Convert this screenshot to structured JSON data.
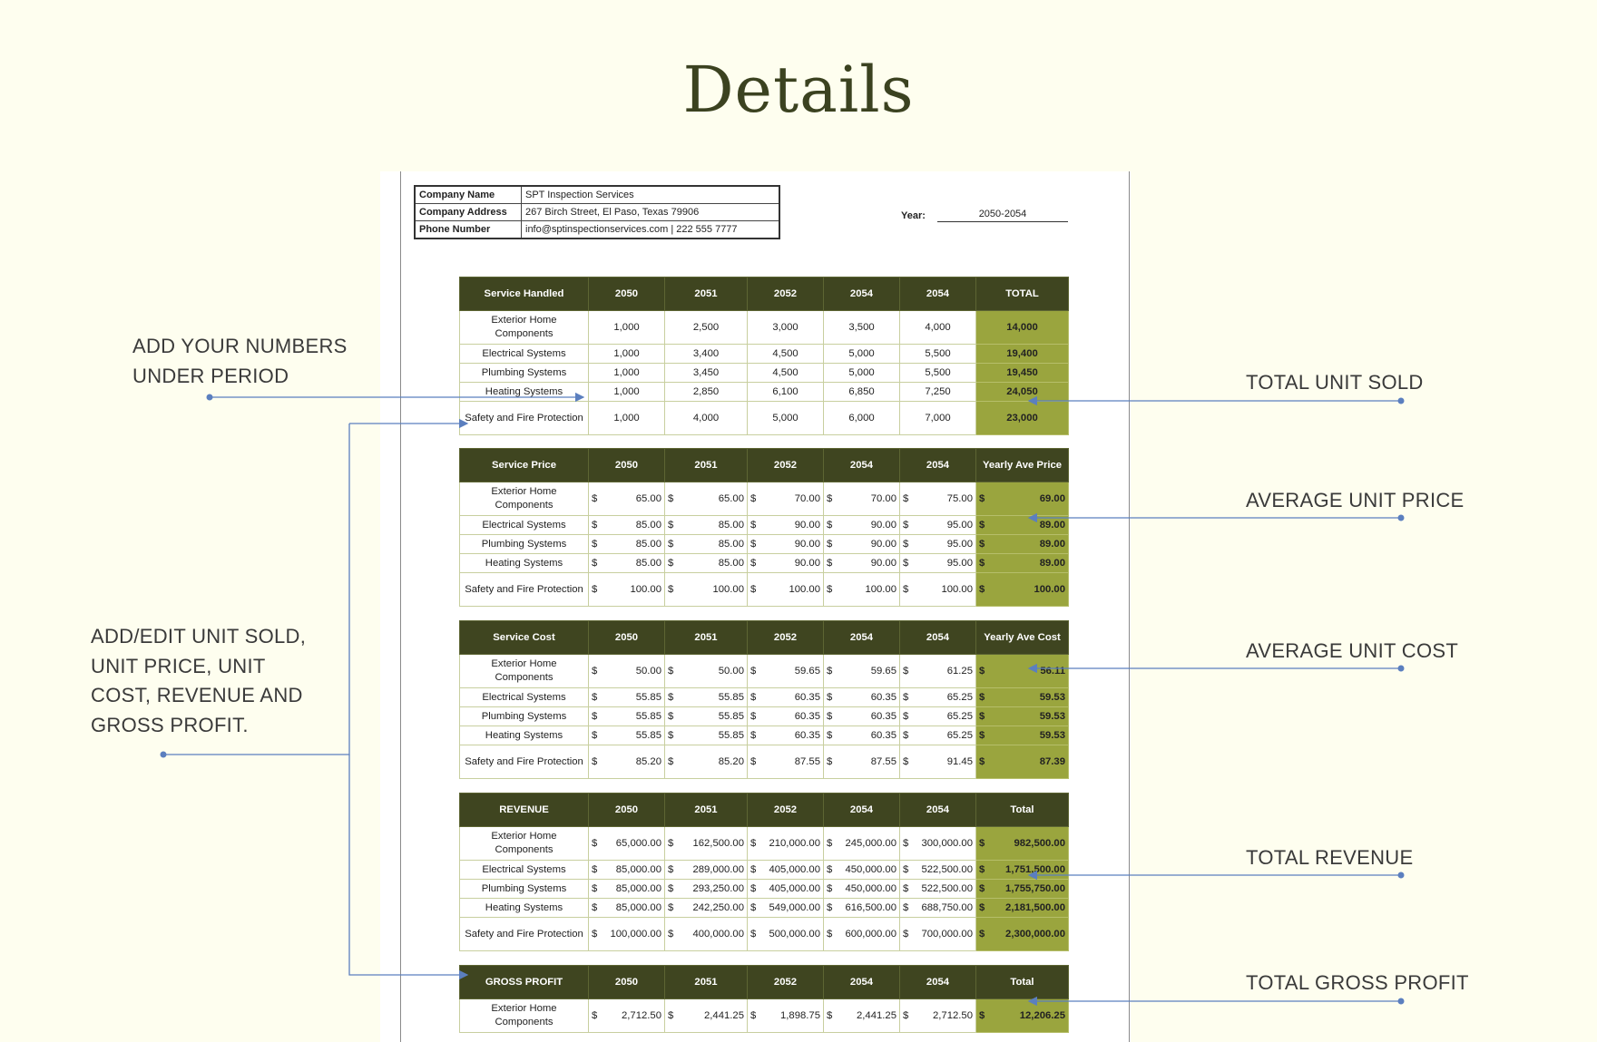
{
  "title": "Details",
  "company": {
    "rows": [
      {
        "label": "Company Name",
        "value": "SPT Inspection Services"
      },
      {
        "label": "Company Address",
        "value": "267 Birch Street, El Paso, Texas 79906"
      },
      {
        "label": "Phone Number",
        "value": "info@sptinspectionservices.com  |  222 555 7777"
      }
    ],
    "year_label": "Year:",
    "year_value": "2050-2054"
  },
  "services": [
    "Exterior Home Components",
    "Electrical Systems",
    "Plumbing Systems",
    "Heating Systems",
    "Safety and Fire Protection"
  ],
  "years": [
    "2050",
    "2051",
    "2052",
    "2054",
    "2054"
  ],
  "tables": [
    {
      "header": "Service Handled",
      "total_header": "TOTAL",
      "currency": false,
      "rows": [
        [
          "1,000",
          "2,500",
          "3,000",
          "3,500",
          "4,000",
          "14,000"
        ],
        [
          "1,000",
          "3,400",
          "4,500",
          "5,000",
          "5,500",
          "19,400"
        ],
        [
          "1,000",
          "3,450",
          "4,500",
          "5,000",
          "5,500",
          "19,450"
        ],
        [
          "1,000",
          "2,850",
          "6,100",
          "6,850",
          "7,250",
          "24,050"
        ],
        [
          "1,000",
          "4,000",
          "5,000",
          "6,000",
          "7,000",
          "23,000"
        ]
      ]
    },
    {
      "header": "Service Price",
      "total_header": "Yearly Ave Price",
      "currency": true,
      "rows": [
        [
          "65.00",
          "65.00",
          "70.00",
          "70.00",
          "75.00",
          "69.00"
        ],
        [
          "85.00",
          "85.00",
          "90.00",
          "90.00",
          "95.00",
          "89.00"
        ],
        [
          "85.00",
          "85.00",
          "90.00",
          "90.00",
          "95.00",
          "89.00"
        ],
        [
          "85.00",
          "85.00",
          "90.00",
          "90.00",
          "95.00",
          "89.00"
        ],
        [
          "100.00",
          "100.00",
          "100.00",
          "100.00",
          "100.00",
          "100.00"
        ]
      ]
    },
    {
      "header": "Service Cost",
      "total_header": "Yearly Ave Cost",
      "currency": true,
      "rows": [
        [
          "50.00",
          "50.00",
          "59.65",
          "59.65",
          "61.25",
          "56.11"
        ],
        [
          "55.85",
          "55.85",
          "60.35",
          "60.35",
          "65.25",
          "59.53"
        ],
        [
          "55.85",
          "55.85",
          "60.35",
          "60.35",
          "65.25",
          "59.53"
        ],
        [
          "55.85",
          "55.85",
          "60.35",
          "60.35",
          "65.25",
          "59.53"
        ],
        [
          "85.20",
          "85.20",
          "87.55",
          "87.55",
          "91.45",
          "87.39"
        ]
      ]
    },
    {
      "header": "REVENUE",
      "total_header": "Total",
      "currency": true,
      "rows": [
        [
          "65,000.00",
          "162,500.00",
          "210,000.00",
          "245,000.00",
          "300,000.00",
          "982,500.00"
        ],
        [
          "85,000.00",
          "289,000.00",
          "405,000.00",
          "450,000.00",
          "522,500.00",
          "1,751,500.00"
        ],
        [
          "85,000.00",
          "293,250.00",
          "405,000.00",
          "450,000.00",
          "522,500.00",
          "1,755,750.00"
        ],
        [
          "85,000.00",
          "242,250.00",
          "549,000.00",
          "616,500.00",
          "688,750.00",
          "2,181,500.00"
        ],
        [
          "100,000.00",
          "400,000.00",
          "500,000.00",
          "600,000.00",
          "700,000.00",
          "2,300,000.00"
        ]
      ]
    },
    {
      "header": "GROSS PROFIT",
      "total_header": "Total",
      "currency": true,
      "rows": [
        [
          "2,712.50",
          "2,441.25",
          "1,898.75",
          "2,441.25",
          "2,712.50",
          "12,206.25"
        ]
      ]
    }
  ],
  "currency_symbol": "$",
  "annotations": {
    "left_1": [
      "ADD YOUR NUMBERS",
      "UNDER PERIOD"
    ],
    "left_2": [
      "ADD/EDIT UNIT SOLD,",
      "UNIT PRICE, UNIT",
      "COST, REVENUE AND",
      "GROSS PROFIT."
    ],
    "right": [
      "TOTAL UNIT SOLD",
      "AVERAGE UNIT PRICE",
      "AVERAGE UNIT COST",
      "TOTAL REVENUE",
      "TOTAL GROSS PROFIT"
    ]
  },
  "colors": {
    "header": "#3f4520",
    "total": "#9aa53e",
    "background": "#fefeef",
    "annotation_line": "#5b7fbf"
  }
}
